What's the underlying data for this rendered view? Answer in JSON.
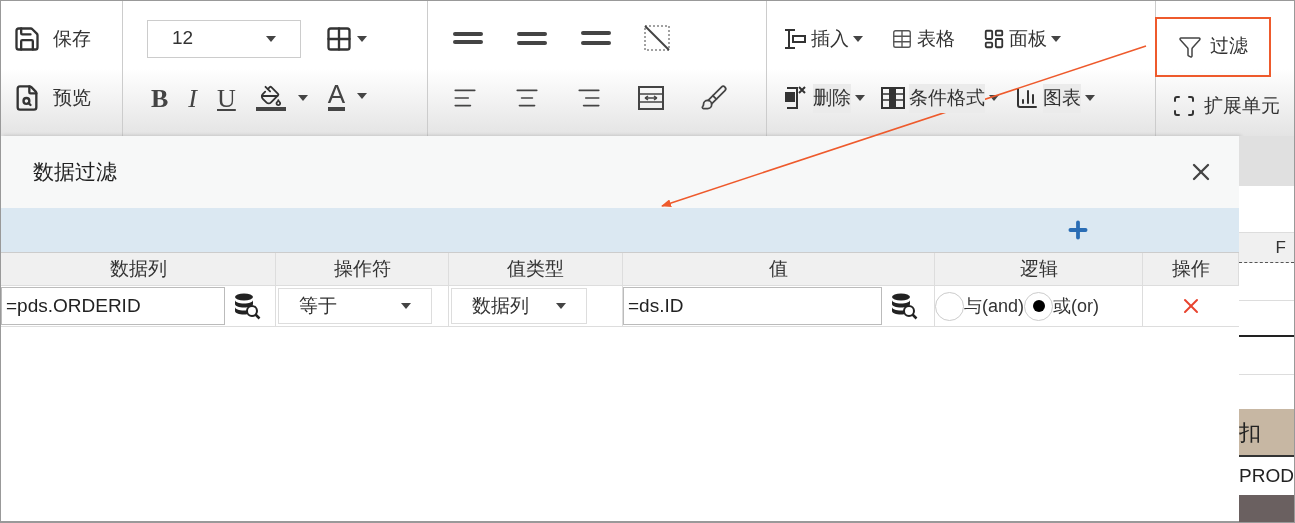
{
  "toolbar": {
    "file_buttons": [
      {
        "kind": "save",
        "label": "保存"
      },
      {
        "kind": "preview",
        "label": "预览"
      }
    ],
    "font_size": "12",
    "text_style_buttons": [
      {
        "kind": "bold",
        "label": "B"
      },
      {
        "kind": "italic",
        "label": "I"
      },
      {
        "kind": "underline",
        "label": "U"
      }
    ],
    "font_color_label": "A",
    "insert_buttons": [
      {
        "kind": "insert",
        "label": "插入",
        "has_dropdown": true
      },
      {
        "kind": "table",
        "label": "表格",
        "has_dropdown": false
      },
      {
        "kind": "panel",
        "label": "面板",
        "has_dropdown": true
      }
    ],
    "edit_buttons": [
      {
        "kind": "delete",
        "label": "删除",
        "has_dropdown": true
      },
      {
        "kind": "conditional",
        "label": "条件格式",
        "has_dropdown": true
      },
      {
        "kind": "chart",
        "label": "图表",
        "has_dropdown": true
      }
    ],
    "filter_button": {
      "label": "过滤",
      "highlighted": true
    },
    "expand_button": {
      "label": "扩展单元"
    }
  },
  "dialog": {
    "title": "数据过滤",
    "columns": [
      "数据列",
      "操作符",
      "值类型",
      "值",
      "逻辑",
      "操作"
    ],
    "rows": [
      {
        "data_column": "=pds.ORDERID",
        "operator": "等于",
        "value_type": "数据列",
        "value": "=ds.ID",
        "logic": [
          {
            "label": "与(and)",
            "selected": false
          },
          {
            "label": "或(or)",
            "selected": true
          }
        ]
      }
    ]
  },
  "sheet": {
    "column_header": "F",
    "header_cell": "扣",
    "data_cell": "PROD"
  }
}
